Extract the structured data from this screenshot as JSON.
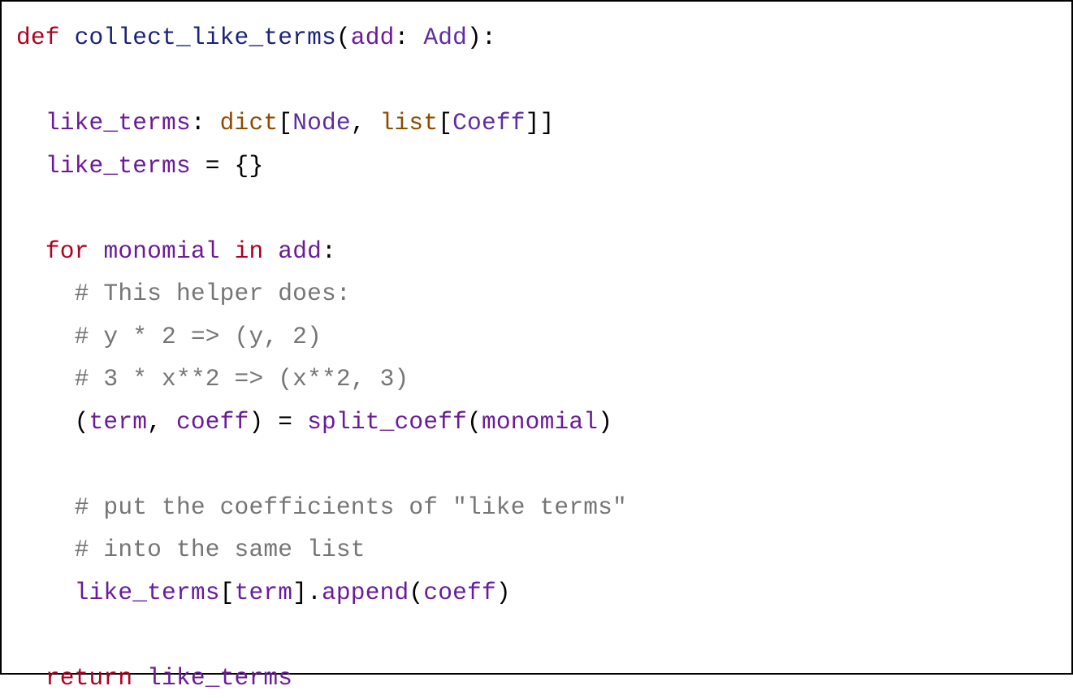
{
  "code": {
    "l1": {
      "kw_def": "def",
      "fn": "collect_like_terms",
      "p1": "(",
      "arg": "add",
      "colon1": ": ",
      "ty": "Add",
      "p2": "):"
    },
    "l2": "",
    "l3": {
      "indent": "  ",
      "var": "like_terms",
      "colon": ": ",
      "dict": "dict",
      "b1": "[",
      "node": "Node",
      "comma": ", ",
      "list": "list",
      "b2": "[",
      "coeff": "Coeff",
      "b3": "]]"
    },
    "l4": {
      "indent": "  ",
      "var": "like_terms",
      "eq": " = {}"
    },
    "l5": "",
    "l6": {
      "indent": "  ",
      "kw_for": "for",
      "sp1": " ",
      "it": "monomial",
      "sp2": " ",
      "kw_in": "in",
      "sp3": " ",
      "seq": "add",
      "colon": ":"
    },
    "l7": {
      "indent": "    ",
      "cm": "# This helper does:"
    },
    "l8": {
      "indent": "    ",
      "cm": "# y * 2 => (y, 2)"
    },
    "l9": {
      "indent": "    ",
      "cm": "# 3 * x**2 => (x**2, 3)"
    },
    "l10": {
      "indent": "    ",
      "p1": "(",
      "t": "term",
      "comma": ", ",
      "c": "coeff",
      "p2": ") = ",
      "fn": "split_coeff",
      "p3": "(",
      "arg": "monomial",
      "p4": ")"
    },
    "l11": "",
    "l12": {
      "indent": "    ",
      "cm": "# put the coefficients of \"like terms\""
    },
    "l13": {
      "indent": "    ",
      "cm": "# into the same list"
    },
    "l14": {
      "indent": "    ",
      "obj": "like_terms",
      "b1": "[",
      "key": "term",
      "b2": "].",
      "method": "append",
      "p1": "(",
      "arg": "coeff",
      "p2": ")"
    },
    "l15": "",
    "l16": {
      "indent": "  ",
      "kw_return": "return",
      "sp": " ",
      "val": "like_terms"
    }
  }
}
